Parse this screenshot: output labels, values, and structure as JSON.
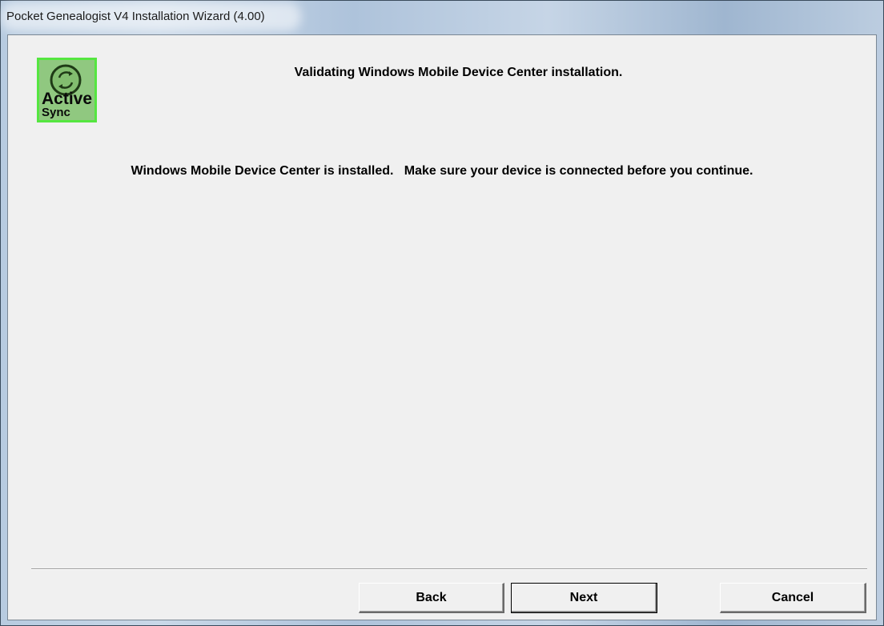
{
  "window": {
    "title": "Pocket Genealogist V4 Installation Wizard (4.00)"
  },
  "logo": {
    "icon": "activesync-icon",
    "line1": "Active",
    "line2": "Sync",
    "border_color": "#55e640",
    "fill_color": "#90c880"
  },
  "content": {
    "heading": "Validating Windows Mobile Device Center installation.",
    "message": "Windows Mobile Device Center is installed.   Make sure your device is connected before you continue."
  },
  "buttons": {
    "back": "Back",
    "next": "Next",
    "cancel": "Cancel"
  }
}
